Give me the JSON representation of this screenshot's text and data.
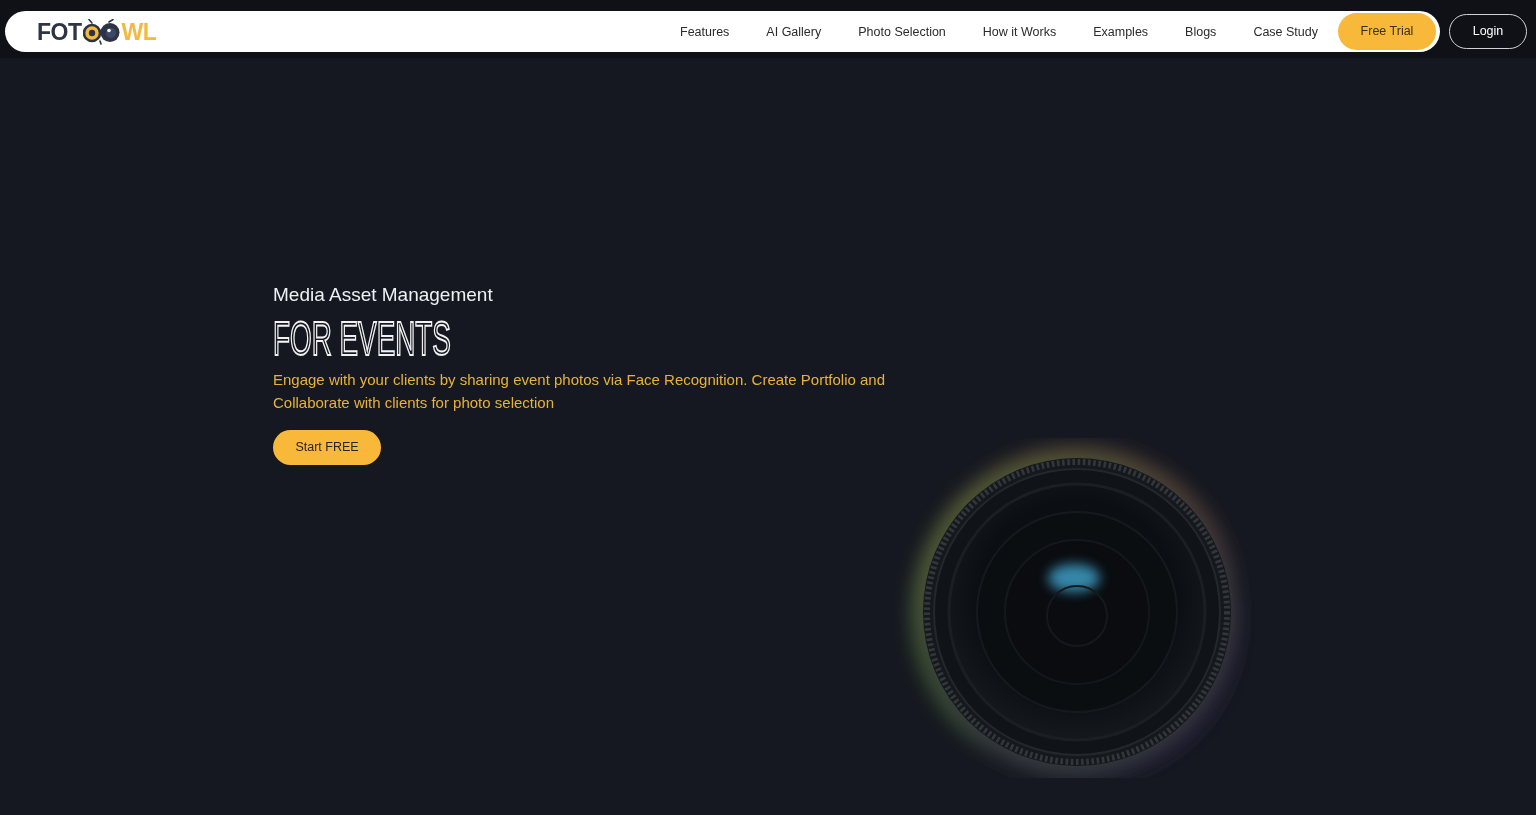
{
  "logo": {
    "text_start": "FOT",
    "text_end": "WL"
  },
  "nav": {
    "links": [
      "Features",
      "AI Gallery",
      "Photo Selection",
      "How it Works",
      "Examples",
      "Blogs",
      "Case Study"
    ],
    "trial_button": "Free Trial",
    "login_button": "Login"
  },
  "hero": {
    "subtitle": "Media Asset Management",
    "title": "FOR EVENTS",
    "description": "Engage with your clients by sharing event photos via Face Recognition. Create Portfolio and Collaborate with clients for photo selection",
    "cta": "Start FREE"
  }
}
